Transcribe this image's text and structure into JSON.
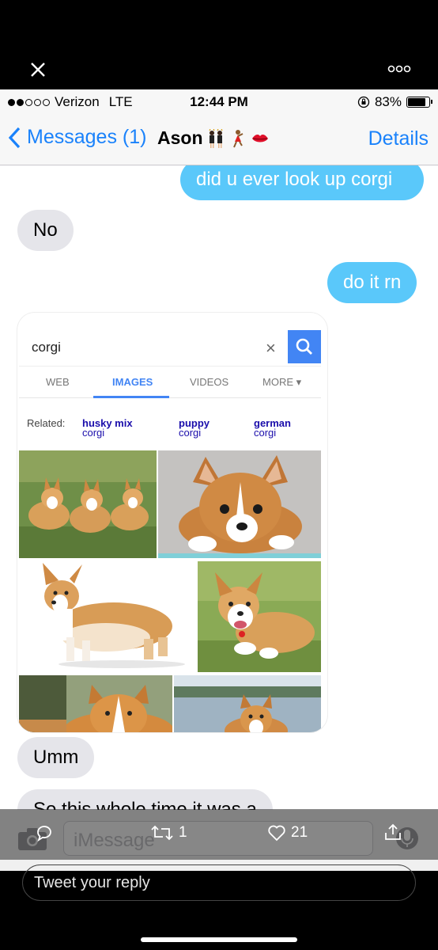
{
  "viewer": {
    "close_icon": "close-icon",
    "more_icon": "more-icon",
    "reply_count": "",
    "retweet_count": "1",
    "like_count": "21",
    "reply_placeholder": "Tweet your reply"
  },
  "status_bar": {
    "carrier": "Verizon",
    "network": "LTE",
    "time": "12:44 PM",
    "battery": "83%",
    "battery_level": 0.83
  },
  "nav": {
    "back_label": "Messages (1)",
    "contact_name": "Ason",
    "details_label": "Details"
  },
  "messages": [
    {
      "direction": "out",
      "text": "did u ever look up corgi"
    },
    {
      "direction": "in",
      "text": "No"
    },
    {
      "direction": "out",
      "text": "do it rn"
    },
    {
      "direction": "out",
      "type": "image"
    },
    {
      "direction": "in",
      "text": "Umm"
    },
    {
      "direction": "in",
      "text": "So this whole time it was a"
    }
  ],
  "google": {
    "query": "corgi",
    "tabs": [
      "WEB",
      "IMAGES",
      "VIDEOS",
      "MORE"
    ],
    "active_tab": "IMAGES",
    "related_label": "Related:",
    "related": [
      {
        "plain": "corgi ",
        "bold": "husky mix"
      },
      {
        "plain": "corgi ",
        "bold": "puppy"
      },
      {
        "plain": "corgi ",
        "bold": "german"
      }
    ]
  },
  "compose": {
    "placeholder": "iMessage"
  },
  "colors": {
    "imessage_blue": "#5ac8fa",
    "ios_link": "#1a82fb",
    "incoming_gray": "#e5e5ea",
    "google_blue": "#4285f4"
  }
}
